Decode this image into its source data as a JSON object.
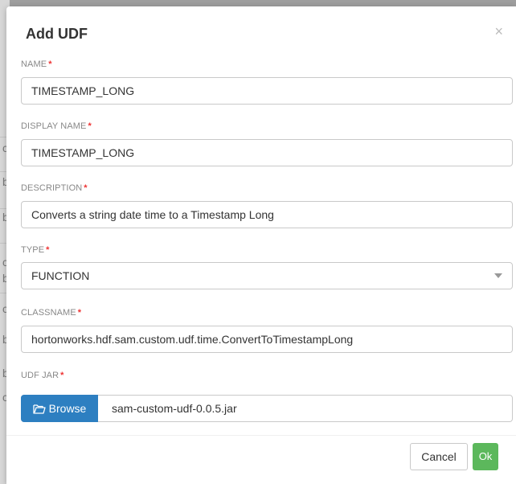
{
  "dialog": {
    "title": "Add UDF",
    "close_symbol": "×"
  },
  "fields": {
    "name": {
      "label": "NAME",
      "required_mark": "*",
      "value": "TIMESTAMP_LONG"
    },
    "display_name": {
      "label": "DISPLAY NAME",
      "required_mark": "*",
      "value": "TIMESTAMP_LONG"
    },
    "description": {
      "label": "DESCRIPTION",
      "required_mark": "*",
      "value": "Converts a string date time to a Timestamp Long"
    },
    "type": {
      "label": "TYPE",
      "required_mark": "*",
      "value": "FUNCTION"
    },
    "classname": {
      "label": "CLASSNAME",
      "required_mark": "*",
      "value": "hortonworks.hdf.sam.custom.udf.time.ConvertToTimestampLong"
    },
    "udf_jar": {
      "label": "UDF JAR",
      "required_mark": "*",
      "browse_label": "Browse",
      "file_name": "sam-custom-udf-0.0.5.jar"
    }
  },
  "footer": {
    "cancel_label": "Cancel",
    "ok_label": "Ok"
  },
  "background_letters": [
    "c",
    "b",
    "b",
    "c",
    "b",
    "c",
    "b",
    "b",
    "c"
  ],
  "icons": {
    "close": "close-icon",
    "browse": "folder-open-icon",
    "select": "chevron-down-icon"
  },
  "colors": {
    "primary": "#2d7fc1",
    "success": "#5cb85c",
    "required": "#ee3333"
  }
}
